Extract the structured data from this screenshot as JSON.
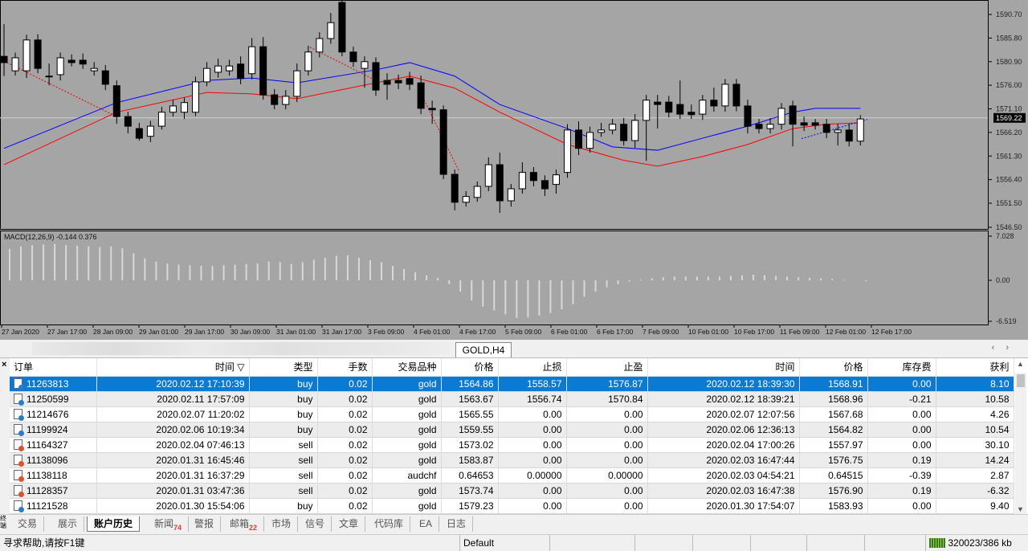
{
  "chart_data": {
    "type": "candlestick",
    "symbol_tab": "GOLD,H4",
    "ylim": [
      1546.5,
      1593.7
    ],
    "price_ticks": [
      "1590.70",
      "1585.80",
      "1580.90",
      "1576.00",
      "1571.10",
      "1566.20",
      "1561.30",
      "1556.40",
      "1551.50",
      "1546.50"
    ],
    "current_price": "1569.22",
    "candles": [
      [
        1582.0,
        1588.7,
        1577.9,
        1580.7
      ],
      [
        1579.0,
        1582.8,
        1578.0,
        1581.7
      ],
      [
        1579.0,
        1586.5,
        1577.5,
        1585.4
      ],
      [
        1585.4,
        1586.6,
        1578.5,
        1579.5
      ],
      [
        1577.9,
        1580.5,
        1576.0,
        1577.9
      ],
      [
        1578.2,
        1582.8,
        1577.0,
        1581.7
      ],
      [
        1581.2,
        1582.4,
        1579.9,
        1580.7
      ],
      [
        1581.2,
        1582.6,
        1579.4,
        1580.4
      ],
      [
        1579.0,
        1580.8,
        1578.0,
        1579.5
      ],
      [
        1579.0,
        1580.2,
        1575.0,
        1576.2
      ],
      [
        1575.9,
        1577.0,
        1568.0,
        1569.5
      ],
      [
        1569.5,
        1570.5,
        1566.0,
        1567.5
      ],
      [
        1567.0,
        1568.2,
        1564.5,
        1565.0
      ],
      [
        1565.4,
        1568.6,
        1564.2,
        1567.5
      ],
      [
        1567.5,
        1571.5,
        1566.8,
        1570.4
      ],
      [
        1570.4,
        1573.0,
        1569.5,
        1571.7
      ],
      [
        1570.4,
        1573.5,
        1569.0,
        1572.4
      ],
      [
        1570.4,
        1577.8,
        1569.6,
        1576.7
      ],
      [
        1576.7,
        1580.8,
        1575.8,
        1579.5
      ],
      [
        1578.7,
        1581.5,
        1577.6,
        1580.0
      ],
      [
        1579.0,
        1581.3,
        1578.0,
        1580.0
      ],
      [
        1580.4,
        1582.0,
        1576.2,
        1577.4
      ],
      [
        1578.4,
        1585.8,
        1577.2,
        1584.0
      ],
      [
        1584.0,
        1586.0,
        1573.0,
        1574.0
      ],
      [
        1574.0,
        1575.2,
        1571.0,
        1572.0
      ],
      [
        1572.0,
        1575.0,
        1571.0,
        1573.7
      ],
      [
        1573.7,
        1580.5,
        1572.5,
        1579.0
      ],
      [
        1579.0,
        1584.2,
        1578.0,
        1582.9
      ],
      [
        1582.9,
        1587.0,
        1581.8,
        1585.7
      ],
      [
        1585.7,
        1591.0,
        1584.6,
        1589.0
      ],
      [
        1593.2,
        1593.7,
        1582.0,
        1582.9
      ],
      [
        1582.9,
        1584.0,
        1579.8,
        1580.9
      ],
      [
        1579.5,
        1582.0,
        1575.5,
        1580.9
      ],
      [
        1580.7,
        1581.8,
        1573.8,
        1575.0
      ],
      [
        1577.0,
        1578.5,
        1573.0,
        1576.2
      ],
      [
        1577.0,
        1578.2,
        1575.2,
        1576.5
      ],
      [
        1577.4,
        1578.8,
        1575.0,
        1576.2
      ],
      [
        1576.5,
        1578.0,
        1570.0,
        1571.2
      ],
      [
        1571.2,
        1572.8,
        1568.0,
        1570.9
      ],
      [
        1570.9,
        1571.8,
        1556.5,
        1557.5
      ],
      [
        1557.5,
        1558.5,
        1550.0,
        1551.7
      ],
      [
        1551.7,
        1554.0,
        1550.8,
        1552.9
      ],
      [
        1552.7,
        1556.0,
        1551.8,
        1555.0
      ],
      [
        1555.0,
        1561.0,
        1554.0,
        1559.5
      ],
      [
        1559.5,
        1562.0,
        1549.5,
        1552.0
      ],
      [
        1552.0,
        1555.5,
        1550.8,
        1554.5
      ],
      [
        1554.5,
        1560.0,
        1553.5,
        1557.9
      ],
      [
        1557.9,
        1559.0,
        1555.0,
        1556.2
      ],
      [
        1556.2,
        1557.3,
        1553.0,
        1554.5
      ],
      [
        1555.4,
        1558.5,
        1553.5,
        1557.4
      ],
      [
        1557.9,
        1567.9,
        1556.8,
        1566.7
      ],
      [
        1566.7,
        1568.5,
        1561.5,
        1562.9
      ],
      [
        1562.9,
        1567.4,
        1562.0,
        1566.2
      ],
      [
        1566.2,
        1568.2,
        1565.3,
        1566.7
      ],
      [
        1566.7,
        1569.0,
        1565.8,
        1567.9
      ],
      [
        1567.9,
        1569.2,
        1563.5,
        1564.5
      ],
      [
        1564.5,
        1570.0,
        1563.0,
        1568.7
      ],
      [
        1568.7,
        1574.0,
        1560.3,
        1572.9
      ],
      [
        1572.5,
        1574.0,
        1567.0,
        1572.0
      ],
      [
        1572.5,
        1573.8,
        1569.3,
        1570.4
      ],
      [
        1572.0,
        1577.0,
        1569.0,
        1570.0
      ],
      [
        1570.4,
        1572.0,
        1569.0,
        1569.9
      ],
      [
        1570.0,
        1574.0,
        1568.8,
        1572.9
      ],
      [
        1572.9,
        1575.5,
        1570.5,
        1571.7
      ],
      [
        1571.7,
        1577.3,
        1570.5,
        1576.2
      ],
      [
        1576.2,
        1577.3,
        1570.6,
        1571.7
      ],
      [
        1571.7,
        1573.0,
        1566.0,
        1567.5
      ],
      [
        1567.9,
        1569.0,
        1566.0,
        1567.0
      ],
      [
        1567.0,
        1569.2,
        1566.0,
        1567.9
      ],
      [
        1567.9,
        1572.3,
        1566.8,
        1571.2
      ],
      [
        1571.7,
        1572.8,
        1563.3,
        1567.9
      ],
      [
        1568.2,
        1569.5,
        1566.5,
        1567.7
      ],
      [
        1568.2,
        1569.0,
        1566.8,
        1567.7
      ],
      [
        1567.9,
        1569.0,
        1565.0,
        1566.2
      ],
      [
        1566.2,
        1568.0,
        1563.5,
        1566.7
      ],
      [
        1566.7,
        1568.0,
        1563.3,
        1564.4
      ],
      [
        1564.4,
        1569.8,
        1563.5,
        1569.0
      ]
    ],
    "ma_fast": [
      [
        0,
        1562.9
      ],
      [
        10,
        1572.4
      ],
      [
        18,
        1577.0
      ],
      [
        22,
        1577.5
      ],
      [
        26,
        1576.5
      ],
      [
        33,
        1579.2
      ],
      [
        36,
        1580.7
      ],
      [
        40,
        1577.9
      ],
      [
        44,
        1572.0
      ],
      [
        50,
        1567.0
      ],
      [
        54,
        1563.2
      ],
      [
        58,
        1562.5
      ],
      [
        62,
        1565.0
      ],
      [
        66,
        1567.5
      ],
      [
        70,
        1570.4
      ],
      [
        72,
        1571.2
      ],
      [
        76,
        1571.2
      ]
    ],
    "ma_slow": [
      [
        0,
        1559.5
      ],
      [
        10,
        1570.4
      ],
      [
        18,
        1574.5
      ],
      [
        22,
        1574.2
      ],
      [
        26,
        1573.2
      ],
      [
        33,
        1576.5
      ],
      [
        36,
        1577.9
      ],
      [
        40,
        1575.4
      ],
      [
        44,
        1570.4
      ],
      [
        50,
        1563.7
      ],
      [
        55,
        1560.4
      ],
      [
        58,
        1559.2
      ],
      [
        62,
        1561.2
      ],
      [
        66,
        1563.7
      ],
      [
        70,
        1567.0
      ],
      [
        73,
        1567.9
      ],
      [
        76,
        1568.2
      ]
    ],
    "macd": {
      "label": "MACD(12,26,9) -0.144 0.376",
      "ticks": [
        "7.028",
        "0.00",
        "-6.519"
      ],
      "ylim": [
        -6.519,
        7.028
      ],
      "values": [
        5.0,
        5.4,
        5.6,
        5.7,
        5.8,
        5.6,
        5.5,
        5.4,
        5.3,
        5.4,
        5.1,
        4.3,
        3.5,
        3.0,
        2.7,
        2.5,
        2.4,
        2.3,
        2.3,
        2.4,
        2.5,
        2.6,
        2.7,
        3.0,
        2.9,
        2.6,
        2.9,
        3.3,
        3.6,
        3.9,
        4.0,
        3.6,
        3.2,
        2.9,
        2.3,
        1.8,
        1.3,
        0.8,
        0.4,
        -0.6,
        -1.8,
        -3.2,
        -4.2,
        -4.8,
        -5.4,
        -6.0,
        -5.9,
        -5.6,
        -5.2,
        -4.6,
        -3.8,
        -2.6,
        -1.8,
        -1.1,
        -0.6,
        -0.2,
        0.1,
        0.3,
        0.5,
        0.6,
        0.6,
        0.6,
        0.6,
        0.6,
        0.7,
        0.8,
        0.9,
        0.8,
        0.7,
        0.6,
        0.5,
        0.4,
        0.3,
        0.2,
        0.1,
        0.0,
        -0.144
      ]
    },
    "x_labels": [
      "27 Jan 2020",
      "27 Jan 17:00",
      "28 Jan 09:00",
      "29 Jan 01:00",
      "29 Jan 17:00",
      "30 Jan 09:00",
      "31 Jan 01:00",
      "31 Jan 17:00",
      "3 Feb 09:00",
      "4 Feb 01:00",
      "4 Feb 17:00",
      "5 Feb 09:00",
      "6 Feb 01:00",
      "6 Feb 17:00",
      "7 Feb 09:00",
      "10 Feb 01:00",
      "10 Feb 17:00",
      "11 Feb 09:00",
      "12 Feb 01:00",
      "12 Feb 17:00"
    ],
    "colors": {
      "bg": "#a5a5a5",
      "ma_fast": "#0000ff",
      "ma_slow": "#ff0000",
      "bull": "#ffffff",
      "bear": "#000000",
      "macd": "#d8d8d8"
    }
  },
  "terminal": {
    "columns": [
      "订单",
      "时间",
      "类型",
      "手数",
      "交易品种",
      "价格",
      "止损",
      "止盈",
      "时间",
      "价格",
      "库存费",
      "获利"
    ],
    "rows": [
      [
        "11263813",
        "2020.02.12 17:10:39",
        "buy",
        "0.02",
        "gold",
        "1564.86",
        "1558.57",
        "1576.87",
        "2020.02.12 18:39:30",
        "1568.91",
        "0.00",
        "8.10"
      ],
      [
        "11250599",
        "2020.02.11 17:57:09",
        "buy",
        "0.02",
        "gold",
        "1563.67",
        "1556.74",
        "1570.84",
        "2020.02.12 18:39:21",
        "1568.96",
        "-0.21",
        "10.58"
      ],
      [
        "11214676",
        "2020.02.07 11:20:02",
        "buy",
        "0.02",
        "gold",
        "1565.55",
        "0.00",
        "0.00",
        "2020.02.07 12:07:56",
        "1567.68",
        "0.00",
        "4.26"
      ],
      [
        "11199924",
        "2020.02.06 10:19:34",
        "buy",
        "0.02",
        "gold",
        "1559.55",
        "0.00",
        "0.00",
        "2020.02.06 12:36:13",
        "1564.82",
        "0.00",
        "10.54"
      ],
      [
        "11164327",
        "2020.02.04 07:46:13",
        "sell",
        "0.02",
        "gold",
        "1573.02",
        "0.00",
        "0.00",
        "2020.02.04 17:00:26",
        "1557.97",
        "0.00",
        "30.10"
      ],
      [
        "11138096",
        "2020.01.31 16:45:46",
        "sell",
        "0.02",
        "gold",
        "1583.87",
        "0.00",
        "0.00",
        "2020.02.03 16:47:44",
        "1576.75",
        "0.19",
        "14.24"
      ],
      [
        "11138118",
        "2020.01.31 16:37:29",
        "sell",
        "0.02",
        "audchf",
        "0.64653",
        "0.00000",
        "0.00000",
        "2020.02.03 04:54:21",
        "0.64515",
        "-0.39",
        "2.87"
      ],
      [
        "11128357",
        "2020.01.31 03:47:36",
        "sell",
        "0.02",
        "gold",
        "1573.74",
        "0.00",
        "0.00",
        "2020.02.03 16:47:38",
        "1576.90",
        "0.19",
        "-6.32"
      ],
      [
        "11121528",
        "2020.01.30 15:54:06",
        "buy",
        "0.02",
        "gold",
        "1579.23",
        "0.00",
        "0.00",
        "2020.01.30 17:54:07",
        "1583.93",
        "0.00",
        "9.40"
      ]
    ],
    "selected_row": 0,
    "tabs": [
      {
        "label": "交易"
      },
      {
        "label": "展示"
      },
      {
        "label": "账户历史",
        "active": true
      },
      {
        "label": "新闻",
        "badge": "74"
      },
      {
        "label": "警报"
      },
      {
        "label": "邮箱",
        "badge": "22"
      },
      {
        "label": "市场"
      },
      {
        "label": "信号"
      },
      {
        "label": "文章"
      },
      {
        "label": "代码库"
      },
      {
        "label": "EA"
      },
      {
        "label": "日志"
      }
    ],
    "side_label": "终端"
  },
  "status": {
    "help": "寻求帮助,请按F1键",
    "profile": "Default",
    "traffic": "320023/386 kb"
  }
}
